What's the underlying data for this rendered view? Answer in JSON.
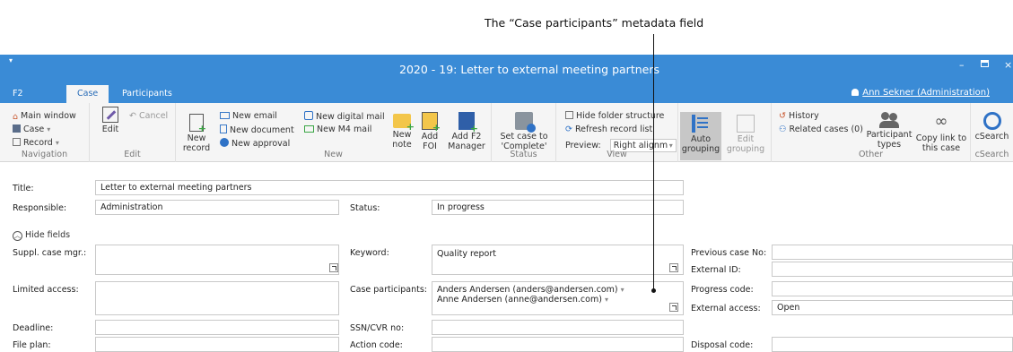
{
  "callout": "The “Case participants” metadata field",
  "window": {
    "title": "2020 - 19: Letter to external meeting partners"
  },
  "tabs": [
    "F2",
    "Case",
    "Participants"
  ],
  "user": "Ann Sekner (Administration)",
  "ribbon": {
    "navigation": {
      "items": [
        "Main window",
        "Case",
        "Record"
      ],
      "label": "Navigation"
    },
    "edit": {
      "edit": "Edit",
      "cancel": "Cancel",
      "label": "Edit"
    },
    "new": {
      "record": "New record",
      "new_email": "New email",
      "new_document": "New document",
      "new_approval": "New approval",
      "new_digital_mail": "New digital mail",
      "new_m4_mail": "New M4 mail",
      "new_note": "New note",
      "add_foi": "Add FOI",
      "add_f2_manager": "Add F2 Manager",
      "label": "New"
    },
    "status": {
      "set_complete": "Set case to 'Complete'",
      "label": "Status"
    },
    "view": {
      "hide_folder": "Hide folder structure",
      "refresh": "Refresh record list",
      "preview_label": "Preview:",
      "preview_value": "Right alignm",
      "label": "View"
    },
    "grouping": {
      "auto": "Auto grouping",
      "edit": "Edit grouping"
    },
    "other": {
      "history": "History",
      "related": "Related cases (0)",
      "participant_types": "Participant types",
      "copy_link": "Copy link to this case",
      "label": "Other"
    },
    "csearch": {
      "btn": "cSearch",
      "label": "cSearch"
    }
  },
  "form": {
    "title_label": "Title:",
    "title_value": "Letter to external meeting partners",
    "responsible_label": "Responsible:",
    "responsible_value": "Administration",
    "status_label": "Status:",
    "status_value": "In progress",
    "hide_fields": "Hide fields",
    "suppl_label": "Suppl. case mgr.:",
    "keyword_label": "Keyword:",
    "keyword_value": "Quality report",
    "prev_case_label": "Previous case No:",
    "external_id_label": "External ID:",
    "limited_label": "Limited access:",
    "case_participants_label": "Case participants:",
    "participants": [
      "Anders Andersen (anders@andersen.com)",
      "Anne Andersen (anne@andersen.com)"
    ],
    "progress_label": "Progress code:",
    "external_access_label": "External access:",
    "external_access_value": "Open",
    "deadline_label": "Deadline:",
    "ssn_label": "SSN/CVR no:",
    "fileplan_label": "File plan:",
    "action_label": "Action code:",
    "disposal_label": "Disposal code:"
  },
  "colors": {
    "accent": "#3a8bd6",
    "ribbon_bg": "#f5f5f5",
    "active_tab_text": "#2a6db8"
  }
}
